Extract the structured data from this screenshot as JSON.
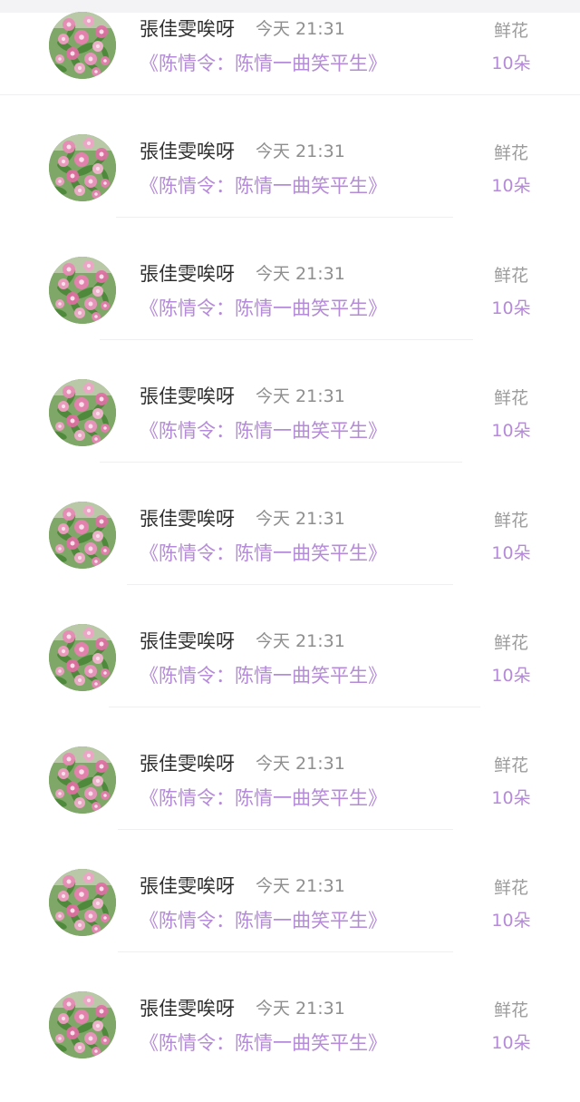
{
  "rows": [
    {
      "name": "張佳雯唉呀",
      "time": "今天 21:31",
      "work": "《陈情令：陈情一曲笑平生》",
      "gift_label": "鲜花",
      "gift_count": "10朵"
    },
    {
      "name": "張佳雯唉呀",
      "time": "今天 21:31",
      "work": "《陈情令：陈情一曲笑平生》",
      "gift_label": "鲜花",
      "gift_count": "10朵"
    },
    {
      "name": "張佳雯唉呀",
      "time": "今天 21:31",
      "work": "《陈情令：陈情一曲笑平生》",
      "gift_label": "鲜花",
      "gift_count": "10朵"
    },
    {
      "name": "張佳雯唉呀",
      "time": "今天 21:31",
      "work": "《陈情令：陈情一曲笑平生》",
      "gift_label": "鲜花",
      "gift_count": "10朵"
    },
    {
      "name": "張佳雯唉呀",
      "time": "今天 21:31",
      "work": "《陈情令：陈情一曲笑平生》",
      "gift_label": "鲜花",
      "gift_count": "10朵"
    },
    {
      "name": "張佳雯唉呀",
      "time": "今天 21:31",
      "work": "《陈情令：陈情一曲笑平生》",
      "gift_label": "鲜花",
      "gift_count": "10朵"
    },
    {
      "name": "張佳雯唉呀",
      "time": "今天 21:31",
      "work": "《陈情令：陈情一曲笑平生》",
      "gift_label": "鲜花",
      "gift_count": "10朵"
    },
    {
      "name": "張佳雯唉呀",
      "time": "今天 21:31",
      "work": "《陈情令：陈情一曲笑平生》",
      "gift_label": "鲜花",
      "gift_count": "10朵"
    },
    {
      "name": "張佳雯唉呀",
      "time": "今天 21:31",
      "work": "《陈情令：陈情一曲笑平生》",
      "gift_label": "鲜花",
      "gift_count": "10朵"
    }
  ],
  "colors": {
    "accent_purple": "#b58ad8",
    "name_text": "#2f2f2f",
    "muted_text": "#8e8e8e",
    "divider": "#efeff2"
  },
  "icons": {
    "avatar": "pink-flower-photo"
  }
}
